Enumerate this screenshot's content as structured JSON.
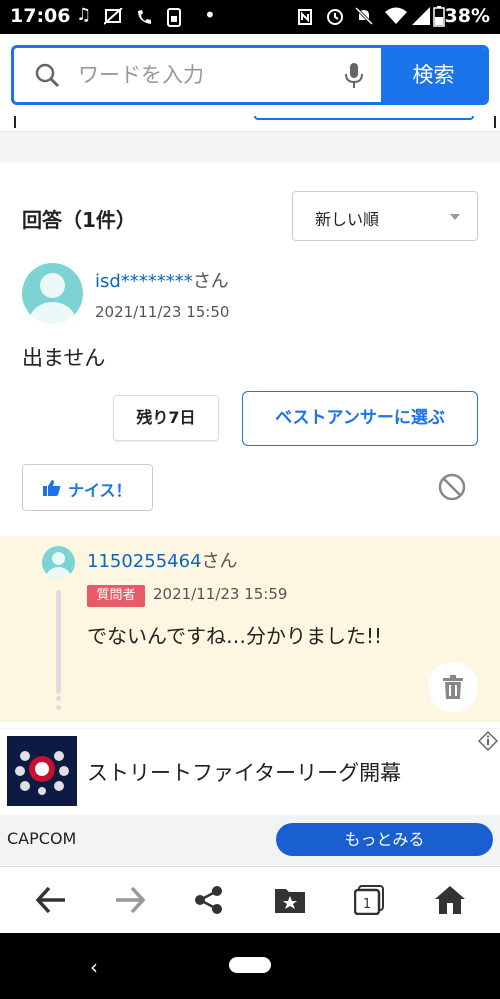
{
  "status_bar": {
    "time": "17:06",
    "battery": "38%",
    "left_icons": [
      "music-note-icon",
      "mute-icon",
      "call-icon",
      "data-saver-icon",
      "dot-icon"
    ],
    "right_icons": [
      "nfc-icon",
      "alarm-icon",
      "do-not-disturb-icon",
      "wifi-icon",
      "signal-icon",
      "battery-icon"
    ]
  },
  "search": {
    "placeholder": "ワードを入力",
    "button_label": "検索"
  },
  "answers": {
    "title": "回答（1件）",
    "sort_label": "新しい順"
  },
  "answer": {
    "user": "isd********",
    "user_suffix": "さん",
    "date": "2021/11/23 15:50",
    "text": "出ません",
    "remaining_label": "残り7日",
    "best_answer_label": "ベストアンサーに選ぶ",
    "nice_label": "ナイス！"
  },
  "reply": {
    "user": "1150255464",
    "user_suffix": "さん",
    "badge": "質問者",
    "date": "2021/11/23 15:59",
    "text": "でないんですね…分かりました!!"
  },
  "ad": {
    "title": "ストリートファイターリーグ開幕",
    "advertiser": "CAPCOM",
    "cta_label": "もっとみる"
  },
  "colors": {
    "accent": "#1a73e8",
    "link": "#0b66c3",
    "badge": "#e85a67",
    "reply_bg": "#fdf7e2",
    "avatar": "#7dd3d3"
  }
}
